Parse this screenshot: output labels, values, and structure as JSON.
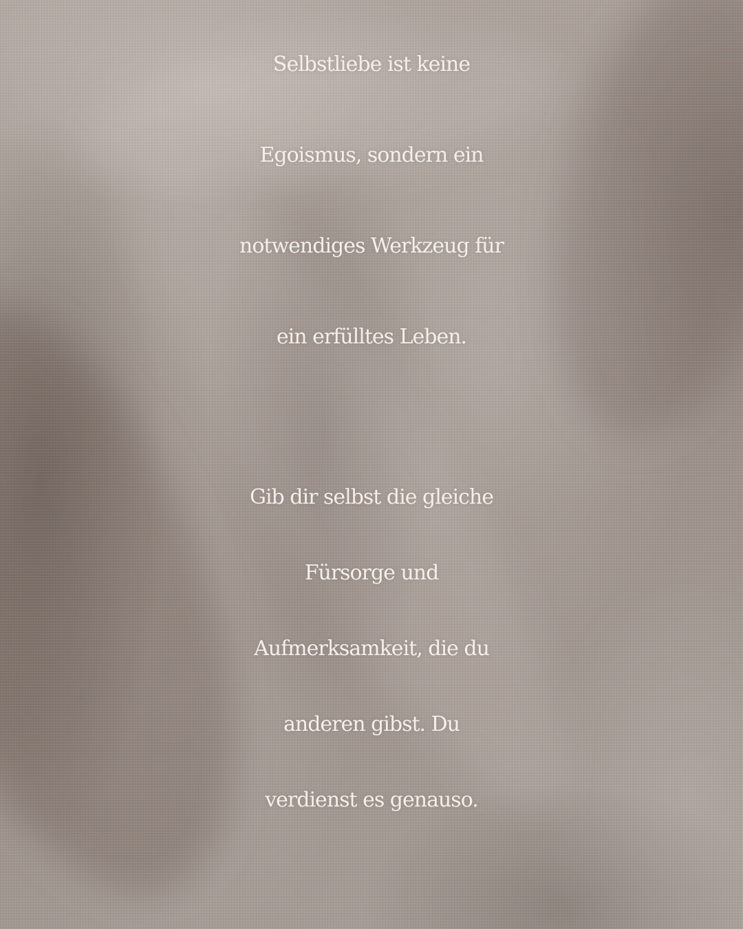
{
  "quote": {
    "paragraph_1": [
      "Selbstliebe ist keine",
      "Egoismus, sondern ein",
      "notwendiges Werkzeug für",
      "ein erfülltes Leben."
    ],
    "paragraph_2": [
      "Gib dir selbst die gleiche",
      "Fürsorge und",
      "Aufmerksamkeit, die du",
      "anderen gibst. Du",
      "verdienst es genauso."
    ]
  },
  "colors": {
    "text": "#f3efec",
    "background": "#a89e97"
  }
}
